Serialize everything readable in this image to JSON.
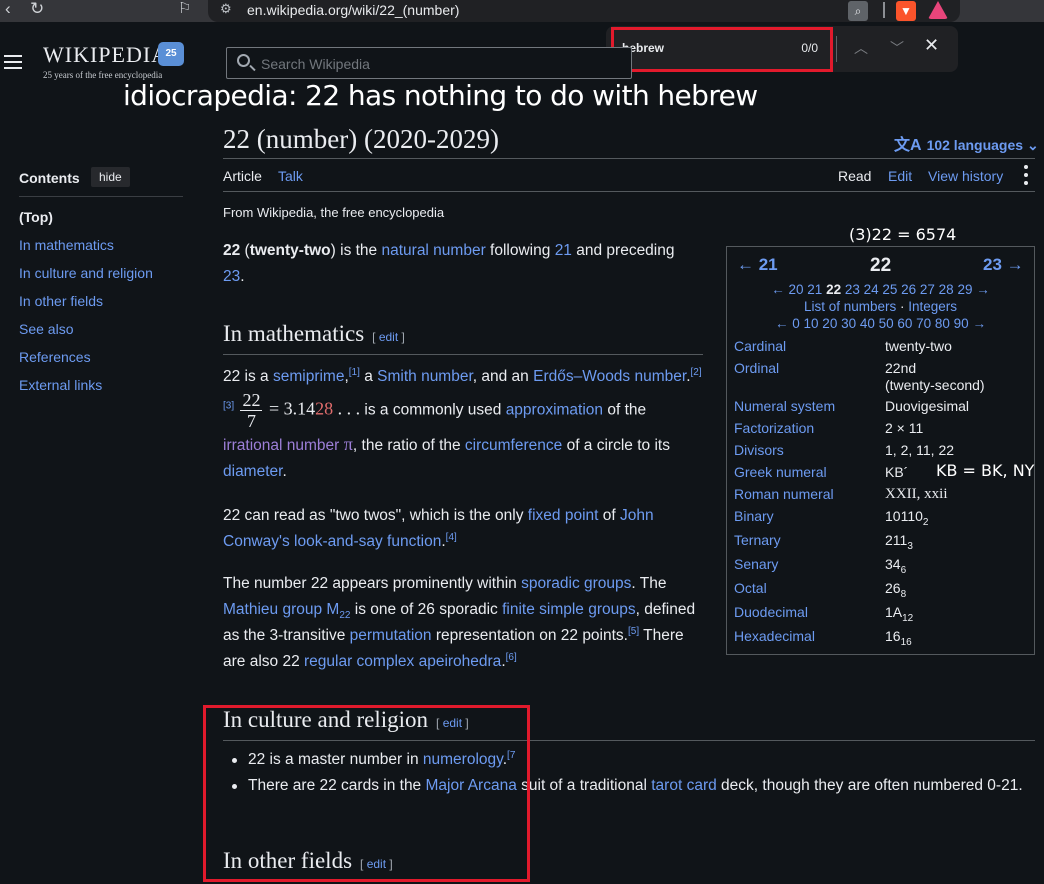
{
  "browser": {
    "url": "en.wikipedia.org/wiki/22_(number)",
    "icons": [
      "back-icon",
      "reload-icon",
      "bookmark-icon",
      "site-settings-icon",
      "find-in-page-icon",
      "brave-shield-icon",
      "brave-rewards-icon"
    ]
  },
  "findbar": {
    "query": "hebrew",
    "count": "0/0"
  },
  "header": {
    "logo_text": "WIKIPEDIA",
    "logo_badge": "25",
    "tagline": "25 years of the free encyclopedia",
    "search_placeholder": "Search Wikipedia"
  },
  "caption": "idiocrapedia: 22 has nothing to do with hebrew",
  "title": "22 (number) (2020-2029)",
  "languages": "102 languages",
  "tabs": {
    "article": "Article",
    "talk": "Talk",
    "read": "Read",
    "edit": "Edit",
    "history": "View history"
  },
  "from_wiki": "From Wikipedia, the free encyclopedia",
  "toc": {
    "title": "Contents",
    "hide": "hide",
    "items": [
      "(Top)",
      "In mathematics",
      "In culture and religion",
      "In other fields",
      "See also",
      "References",
      "External links"
    ]
  },
  "lead": {
    "num": "22",
    "paren_open": " (",
    "word": "twenty-two",
    "text1": ") is the ",
    "link1": "natural number",
    "text2": " following ",
    "link2": "21",
    "text3": " and preceding ",
    "link3": "23",
    "text4": "."
  },
  "sections": {
    "math": {
      "heading": "In mathematics",
      "edit": "edit",
      "p1": {
        "t1": "22 is a ",
        "l1": "semiprime",
        "s1": "[1]",
        "t2": " a ",
        "l2": "Smith number",
        "t3": ", and an ",
        "l3": "Erdős–Woods number",
        "s2": "[2][3]",
        "frac_num": "22",
        "frac_den": "7",
        "approx_a": " = 3.14",
        "approx_b": "28",
        "approx_c": " . . .",
        "t4": " is a commonly used ",
        "l4": "approximation",
        "t5": " of the ",
        "l5": "irrational number",
        "pi": " π",
        "t6": ", the ratio of the ",
        "l6": "circumference",
        "t7": " of a circle to its ",
        "l7": "diameter",
        "t8": "."
      },
      "p2": {
        "t1": "22 can read as \"two twos\", which is the only ",
        "l1": "fixed point",
        "t2": " of ",
        "l2": "John Conway's look-and-say function",
        "s1": "[4]",
        "t3": ""
      },
      "p3": {
        "t1": "The number 22 appears prominently within ",
        "l1": "sporadic groups",
        "t2": ". The ",
        "l2": "Mathieu group M",
        "l2sub": "22",
        "t3": " is one of 26 sporadic ",
        "l3": "finite simple groups",
        "t4": ", defined as the 3-transitive ",
        "l4": "permutation",
        "t5": " representation on 22 points.",
        "s1": "[5]",
        "t6": " There are also 22 ",
        "l5": "regular complex apeirohedra",
        "s2": "[6]"
      }
    },
    "culture": {
      "heading": "In culture and religion",
      "edit": "edit",
      "b1": {
        "t1": "22 is a master number in ",
        "l1": "numerology",
        "s1": "[7"
      },
      "b2": {
        "t1": "There are 22 cards in the ",
        "l1": "Major Arcana",
        "t2": " suit of a traditional ",
        "l2": "tarot card",
        "t3": " deck, though they are often numbered 0-21."
      }
    },
    "other": {
      "heading": "In other fields",
      "edit": "edit"
    }
  },
  "infobox": {
    "note": "(3)22 = 6574",
    "prev": "← 21",
    "current": "22",
    "next": "23 →",
    "nav1_pre": "← 20 21 ",
    "nav1_bold": "22",
    "nav1_post": " 23 24 25 26 27 28 29 →",
    "nav2_a": "List of numbers",
    "nav2_dot": " · ",
    "nav2_b": "Integers",
    "nav3": "← 0 10 20 30 40 50 60 70 80 90 →",
    "rows": [
      {
        "k": "Cardinal",
        "v": "twenty-two"
      },
      {
        "k": "Ordinal",
        "v": "22nd",
        "v2": "(twenty-second)"
      },
      {
        "k": "Numeral system",
        "v": "Duovigesimal"
      },
      {
        "k": "Factorization",
        "v": "2 × 11"
      },
      {
        "k": "Divisors",
        "v": "1, 2, 11, 22"
      },
      {
        "k": "Greek numeral",
        "v": "ΚΒ´"
      },
      {
        "k": "Roman numeral",
        "v": "XXII, xxii"
      },
      {
        "k": "Binary",
        "v": "10110",
        "sub": "2"
      },
      {
        "k": "Ternary",
        "v": "211",
        "sub": "3"
      },
      {
        "k": "Senary",
        "v": "34",
        "sub": "6"
      },
      {
        "k": "Octal",
        "v": "26",
        "sub": "8"
      },
      {
        "k": "Duodecimal",
        "v": "1A",
        "sub": "12"
      },
      {
        "k": "Hexadecimal",
        "v": "16",
        "sub": "16"
      }
    ],
    "kb_note": "KB = BK, NY"
  }
}
